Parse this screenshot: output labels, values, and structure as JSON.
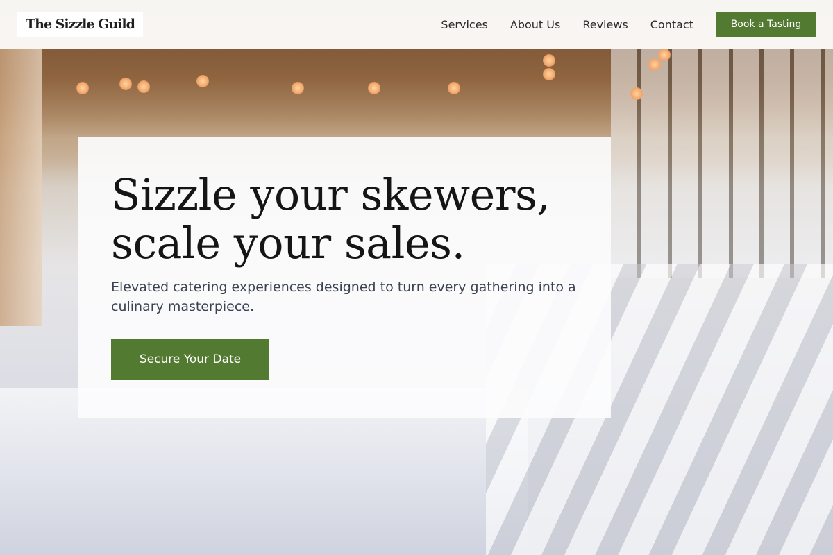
{
  "header": {
    "logo_text": "The Sizzle Guild",
    "nav": [
      {
        "label": "Services"
      },
      {
        "label": "About Us"
      },
      {
        "label": "Reviews"
      },
      {
        "label": "Contact"
      }
    ],
    "cta_label": "Book a Tasting"
  },
  "hero": {
    "title_line1": "Sizzle your skewers,",
    "title_line2": "scale your sales.",
    "subtitle": "Elevated catering experiences designed to turn every gathering into a culinary masterpiece.",
    "cta_label": "Secure Your Date"
  },
  "colors": {
    "accent": "#537a31",
    "text_dark": "#151515",
    "text_muted": "#3b4252"
  }
}
